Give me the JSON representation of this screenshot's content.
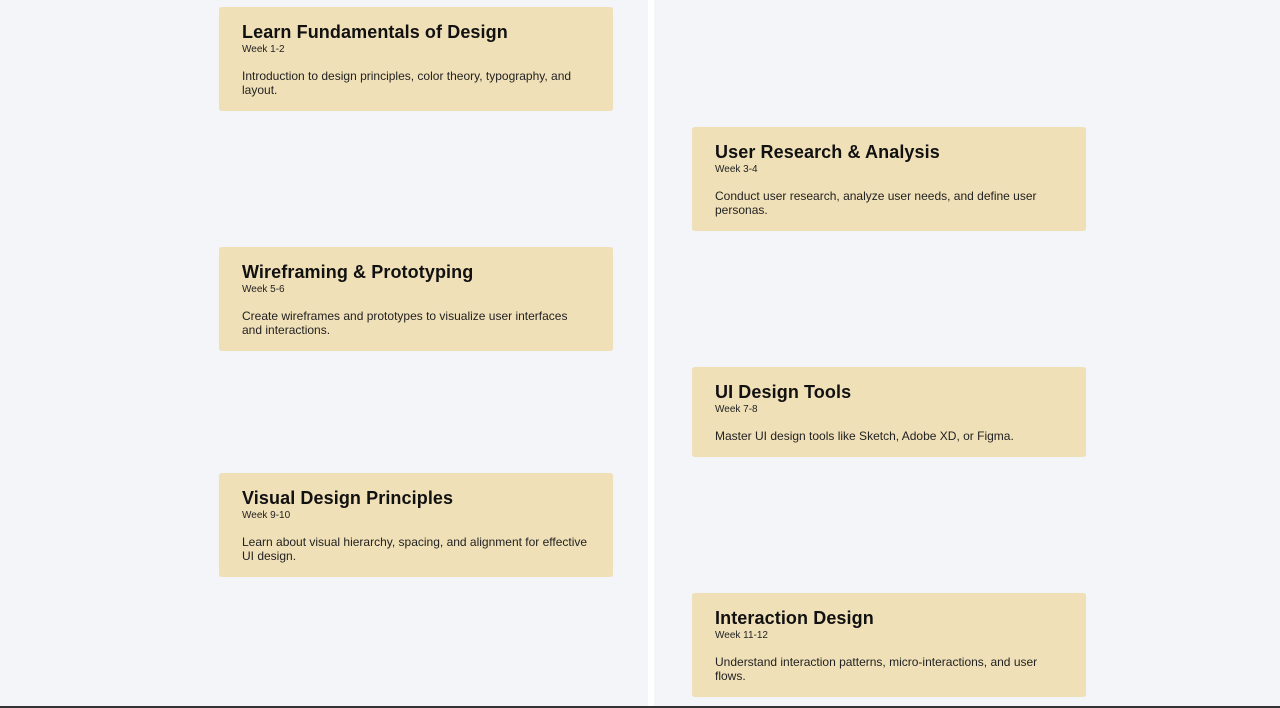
{
  "timeline": {
    "items": [
      {
        "title": "Learn Fundamentals of Design",
        "week": "Week 1-2",
        "description": "Introduction to design principles, color theory, typography, and layout."
      },
      {
        "title": "User Research & Analysis",
        "week": "Week 3-4",
        "description": "Conduct user research, analyze user needs, and define user personas."
      },
      {
        "title": "Wireframing & Prototyping",
        "week": "Week 5-6",
        "description": "Create wireframes and prototypes to visualize user interfaces and interactions."
      },
      {
        "title": "UI Design Tools",
        "week": "Week 7-8",
        "description": "Master UI design tools like Sketch, Adobe XD, or Figma."
      },
      {
        "title": "Visual Design Principles",
        "week": "Week 9-10",
        "description": "Learn about visual hierarchy, spacing, and alignment for effective UI design."
      },
      {
        "title": "Interaction Design",
        "week": "Week 11-12",
        "description": "Understand interaction patterns, micro-interactions, and user flows."
      }
    ]
  }
}
